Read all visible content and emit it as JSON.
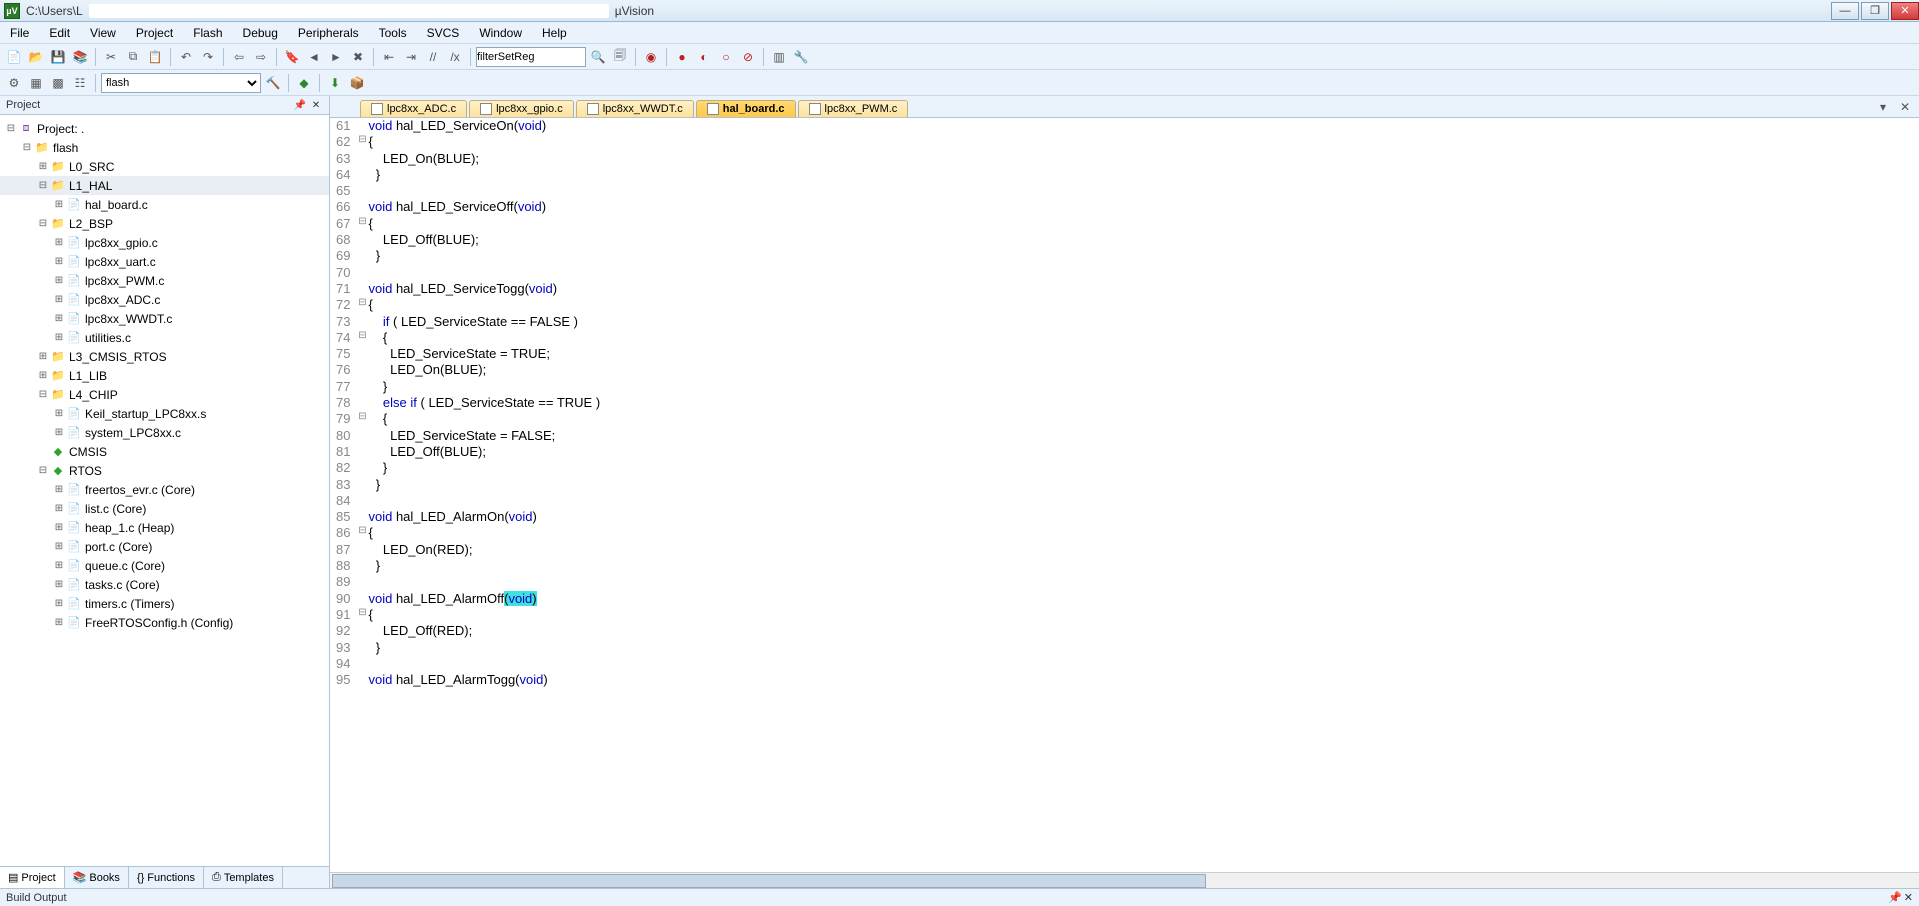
{
  "title": {
    "path": "C:\\Users\\L",
    "app": "µVision"
  },
  "menu": [
    "File",
    "Edit",
    "View",
    "Project",
    "Flash",
    "Debug",
    "Peripherals",
    "Tools",
    "SVCS",
    "Window",
    "Help"
  ],
  "toolbar": {
    "search": "filterSetReg",
    "target": "flash"
  },
  "project": {
    "panel": "Project",
    "root": "Project: .",
    "target": "flash",
    "groups": [
      {
        "name": "L0_SRC",
        "expanded": false,
        "files": []
      },
      {
        "name": "L1_HAL",
        "expanded": true,
        "selected": true,
        "files": [
          "hal_board.c"
        ]
      },
      {
        "name": "L2_BSP",
        "expanded": true,
        "files": [
          "lpc8xx_gpio.c",
          "lpc8xx_uart.c",
          "lpc8xx_PWM.c",
          "lpc8xx_ADC.c",
          "lpc8xx_WWDT.c",
          "utilities.c"
        ]
      },
      {
        "name": "L3_CMSIS_RTOS",
        "expanded": false,
        "files": []
      },
      {
        "name": "L1_LIB",
        "expanded": false,
        "files": []
      },
      {
        "name": "L4_CHIP",
        "expanded": true,
        "files": [
          "Keil_startup_LPC8xx.s",
          "system_LPC8xx.c"
        ]
      }
    ],
    "components": [
      {
        "name": "CMSIS",
        "icon": "diamond"
      },
      {
        "name": "RTOS",
        "icon": "diamond",
        "expanded": true,
        "files": [
          "freertos_evr.c (Core)",
          "list.c (Core)",
          "heap_1.c (Heap)",
          "port.c (Core)",
          "queue.c (Core)",
          "tasks.c (Core)",
          "timers.c (Timers)",
          "FreeRTOSConfig.h (Config)"
        ]
      }
    ],
    "tabs": [
      "Project",
      "Books",
      "Functions",
      "Templates"
    ]
  },
  "editor": {
    "tabs": [
      {
        "name": "lpc8xx_ADC.c"
      },
      {
        "name": "lpc8xx_gpio.c"
      },
      {
        "name": "lpc8xx_WWDT.c"
      },
      {
        "name": "hal_board.c",
        "active": true
      },
      {
        "name": "lpc8xx_PWM.c"
      }
    ],
    "code": {
      "start": 61,
      "lines": [
        {
          "t": [
            [
              "kw",
              "void"
            ],
            [
              "",
              " hal_LED_ServiceOn("
            ],
            [
              "kw",
              "void"
            ],
            [
              "",
              ")"
            ]
          ]
        },
        {
          "fold": "-",
          "t": [
            [
              "",
              "{"
            ]
          ]
        },
        {
          "t": [
            [
              "",
              "    LED_On(BLUE);"
            ]
          ]
        },
        {
          "t": [
            [
              "",
              "  }"
            ]
          ]
        },
        {
          "t": [
            [
              "",
              ""
            ]
          ]
        },
        {
          "t": [
            [
              "kw",
              "void"
            ],
            [
              "",
              " hal_LED_ServiceOff("
            ],
            [
              "kw",
              "void"
            ],
            [
              "",
              ")"
            ]
          ]
        },
        {
          "fold": "-",
          "t": [
            [
              "",
              "{"
            ]
          ]
        },
        {
          "t": [
            [
              "",
              "    LED_Off(BLUE);"
            ]
          ]
        },
        {
          "t": [
            [
              "",
              "  }"
            ]
          ]
        },
        {
          "t": [
            [
              "",
              ""
            ]
          ]
        },
        {
          "t": [
            [
              "kw",
              "void"
            ],
            [
              "",
              " hal_LED_ServiceTogg("
            ],
            [
              "kw",
              "void"
            ],
            [
              "",
              ")"
            ]
          ]
        },
        {
          "fold": "-",
          "t": [
            [
              "",
              "{"
            ]
          ]
        },
        {
          "t": [
            [
              "",
              "    "
            ],
            [
              "kw",
              "if"
            ],
            [
              "",
              " ( LED_ServiceState == FALSE )"
            ]
          ]
        },
        {
          "fold": "-",
          "t": [
            [
              "",
              "    {"
            ]
          ]
        },
        {
          "t": [
            [
              "",
              "      LED_ServiceState = TRUE;"
            ]
          ]
        },
        {
          "t": [
            [
              "",
              "      LED_On(BLUE);"
            ]
          ]
        },
        {
          "t": [
            [
              "",
              "    }"
            ]
          ]
        },
        {
          "t": [
            [
              "",
              "    "
            ],
            [
              "kw",
              "else if"
            ],
            [
              "",
              " ( LED_ServiceState == TRUE )"
            ]
          ]
        },
        {
          "fold": "-",
          "t": [
            [
              "",
              "    {"
            ]
          ]
        },
        {
          "t": [
            [
              "",
              "      LED_ServiceState = FALSE;"
            ]
          ]
        },
        {
          "t": [
            [
              "",
              "      LED_Off(BLUE);"
            ]
          ]
        },
        {
          "t": [
            [
              "",
              "    }"
            ]
          ]
        },
        {
          "t": [
            [
              "",
              "  }"
            ]
          ]
        },
        {
          "t": [
            [
              "",
              ""
            ]
          ]
        },
        {
          "t": [
            [
              "kw",
              "void"
            ],
            [
              "",
              " hal_LED_AlarmOn("
            ],
            [
              "kw",
              "void"
            ],
            [
              "",
              ")"
            ]
          ]
        },
        {
          "fold": "-",
          "t": [
            [
              "",
              "{"
            ]
          ]
        },
        {
          "t": [
            [
              "",
              "    LED_On(RED);"
            ]
          ]
        },
        {
          "t": [
            [
              "",
              "  }"
            ]
          ]
        },
        {
          "t": [
            [
              "",
              ""
            ]
          ]
        },
        {
          "t": [
            [
              "kw",
              "void"
            ],
            [
              "",
              " hal_LED_AlarmOff"
            ],
            [
              "hl",
              "("
            ],
            [
              "kw hl",
              "void"
            ],
            [
              "hl",
              ")"
            ]
          ]
        },
        {
          "fold": "-",
          "t": [
            [
              "",
              "{"
            ]
          ]
        },
        {
          "t": [
            [
              "",
              "    LED_Off(RED);"
            ]
          ]
        },
        {
          "t": [
            [
              "",
              "  }"
            ]
          ]
        },
        {
          "t": [
            [
              "",
              ""
            ]
          ]
        },
        {
          "t": [
            [
              "kw",
              "void"
            ],
            [
              "",
              " hal_LED_AlarmTogg("
            ],
            [
              "kw",
              "void"
            ],
            [
              "",
              ")"
            ]
          ]
        }
      ]
    }
  },
  "output": {
    "label": "Build Output"
  }
}
